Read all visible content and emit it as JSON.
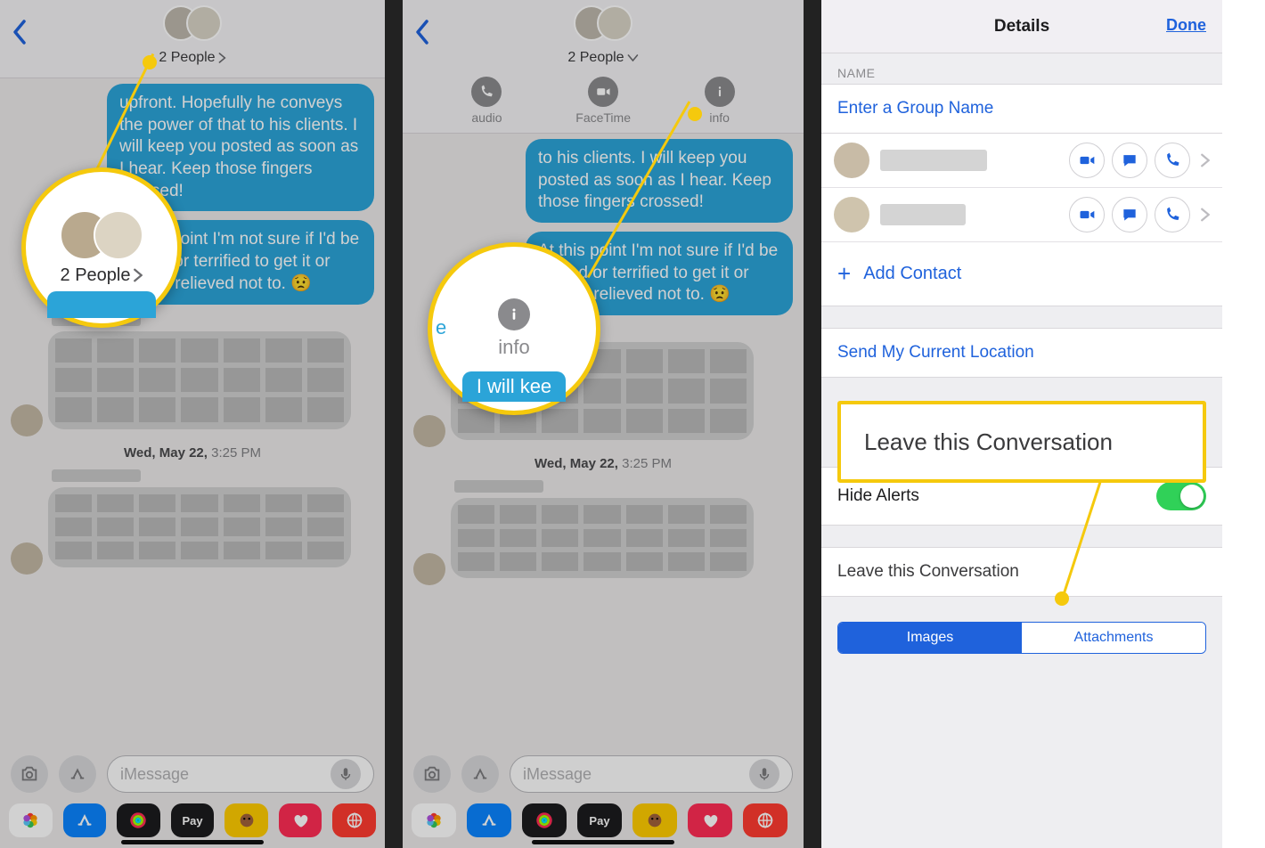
{
  "panel1": {
    "people_label": "2 People",
    "msg1": "upfront.  Hopefully he conveys the power of that to his clients.  I will keep you posted as soon as I hear. Keep those fingers crossed!",
    "msg2": "At this point I'm not sure if I'd be thrilled or terrified to get it or maybe relieved not to. 😟",
    "date_bold": "Wed, May 22,",
    "date_rest": "3:25 PM",
    "compose_placeholder": "iMessage",
    "zoom_label": "2 People"
  },
  "panel2": {
    "people_label": "2 People",
    "actions": {
      "audio": "audio",
      "facetime": "FaceTime",
      "info": "info"
    },
    "msg1": "to his clients.  I will keep you posted as soon as I hear. Keep those fingers crossed!",
    "msg2": "At this point I'm not sure if I'd be thrilled or terrified to get it or maybe relieved not to. 😟",
    "date_bold": "Wed, May 22,",
    "date_rest": "3:25 PM",
    "compose_placeholder": "iMessage",
    "zoom_info": "info",
    "zoom_snip": "I will kee"
  },
  "panel3": {
    "title": "Details",
    "done": "Done",
    "name_label": "NAME",
    "enter_name": "Enter a Group Name",
    "add_contact": "Add Contact",
    "send_loc": "Send My Current Location",
    "hide_alerts": "Hide Alerts",
    "leave": "Leave this Conversation",
    "seg_images": "Images",
    "seg_attach": "Attachments",
    "zoom_leave": "Leave this Conversation"
  },
  "apps": {
    "pay": "Pay"
  }
}
